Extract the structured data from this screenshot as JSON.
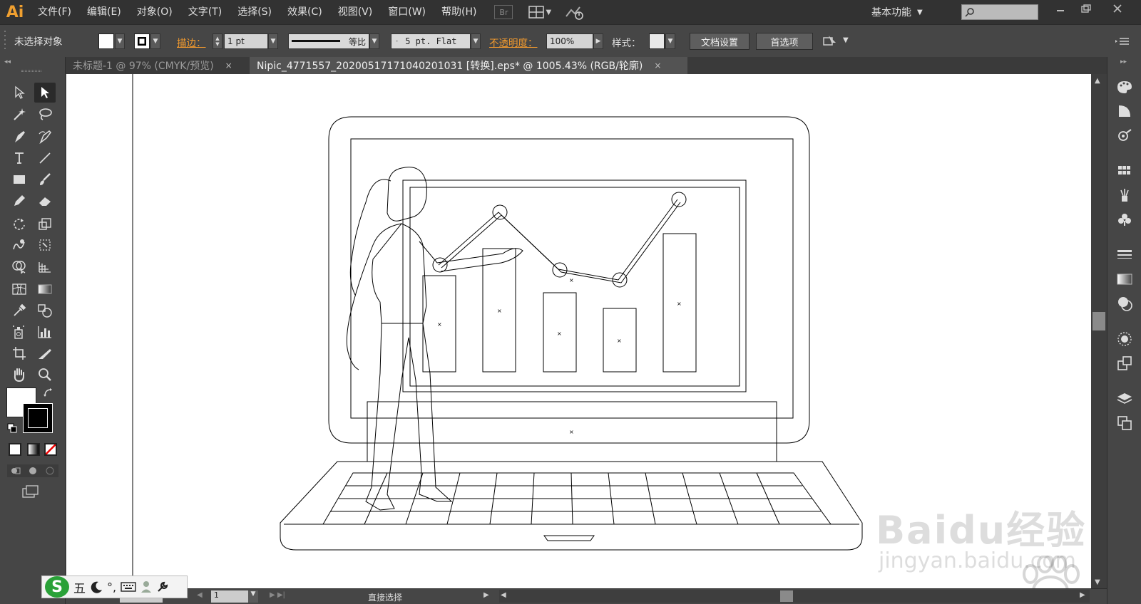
{
  "app": {
    "logo": "Ai"
  },
  "menu": [
    "文件(F)",
    "编辑(E)",
    "对象(O)",
    "文字(T)",
    "选择(S)",
    "效果(C)",
    "视图(V)",
    "窗口(W)",
    "帮助(H)"
  ],
  "menubar": {
    "bridge_label": "Br",
    "workspace": "基本功能",
    "search_placeholder": ""
  },
  "control": {
    "selection_status": "未选择对象",
    "stroke_label": "描边：",
    "stroke_weight": "1 pt",
    "profile_label": "等比",
    "brush_label": "5 pt. Flat",
    "opacity_label": "不透明度：",
    "opacity_value": "100%",
    "style_label": "样式：",
    "doc_setup": "文档设置",
    "preferences": "首选项"
  },
  "tabs": [
    {
      "label": "未标题-1 @ 97% (CMYK/预览)",
      "close": "×",
      "active": false
    },
    {
      "label": "Nipic_4771557_20200517171040201031 [转换].eps* @ 1005.43% (RGB/轮廓)",
      "close": "×",
      "active": true
    }
  ],
  "status": {
    "zoom": "1005.4",
    "artboard": "1",
    "tool": "直接选择"
  },
  "ime": {
    "logo": "S",
    "mode": "五"
  },
  "watermark": {
    "brand": "Baidu经验",
    "url": "jingyan.baidu.com"
  },
  "colors": {
    "accent": "#f29a2e",
    "menubar": "#323232",
    "panel": "#464646",
    "canvas": "#ffffff"
  },
  "icons": {
    "left_tools": [
      "selection-icon",
      "direct-selection-icon",
      "magic-wand-icon",
      "lasso-icon",
      "pen-icon",
      "curvature-icon",
      "type-icon",
      "line-icon",
      "rectangle-icon",
      "paintbrush-icon",
      "pencil-icon",
      "eraser-icon",
      "rotate-icon",
      "scale-icon",
      "warp-icon",
      "free-transform-icon",
      "shape-builder-icon",
      "perspective-icon",
      "mesh-icon",
      "gradient-icon",
      "eyedropper-icon",
      "blend-icon",
      "symbol-sprayer-icon",
      "column-graph-icon",
      "artboard-icon",
      "slice-icon",
      "hand-icon",
      "zoom-icon"
    ],
    "right_panels": [
      "color-icon",
      "color-guide-icon",
      "appearance-icon",
      "swatches-icon",
      "brushes-icon",
      "symbols-icon",
      "stroke-icon",
      "gradient-panel-icon",
      "transparency-icon",
      "graphic-styles-icon",
      "export-icon",
      "layers-icon",
      "artboards-icon"
    ]
  }
}
